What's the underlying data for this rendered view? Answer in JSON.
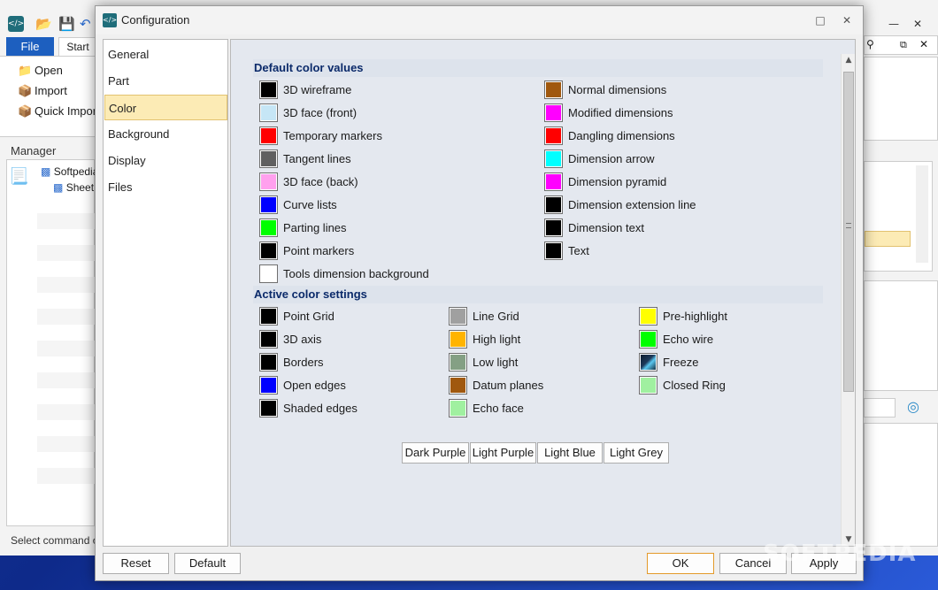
{
  "background_app": {
    "tabs": {
      "file": "File",
      "start": "Start"
    },
    "ribbon": [
      {
        "label": "Open",
        "icon": "folder-open-icon"
      },
      {
        "label": "Import",
        "icon": "import-icon"
      },
      {
        "label": "Quick Import",
        "icon": "quick-import-icon"
      }
    ],
    "manager_title": "Manager",
    "tree": [
      "Softpedia",
      "Sheet"
    ],
    "status_text": "Select command or"
  },
  "dialog": {
    "title": "Configuration",
    "nav": [
      "General",
      "Part",
      "Color",
      "Background",
      "Display",
      "Files"
    ],
    "selected_nav": "Color",
    "sections": [
      {
        "title": "Default color values",
        "columns": [
          [
            {
              "label": "3D wireframe",
              "color": "#000000"
            },
            {
              "label": "3D face (front)",
              "color": "#c6e6f6"
            },
            {
              "label": "Temporary markers",
              "color": "#ff0000"
            },
            {
              "label": "Tangent lines",
              "color": "#606060"
            },
            {
              "label": "3D face (back)",
              "color": "#ffa0ee"
            },
            {
              "label": "Curve lists",
              "color": "#0000ff"
            },
            {
              "label": "Parting lines",
              "color": "#00ff00"
            },
            {
              "label": "Point markers",
              "color": "#000000"
            },
            {
              "label": "Tools dimension background",
              "color": "#ffffff"
            }
          ],
          [
            {
              "label": "Normal dimensions",
              "color": "#a0580e"
            },
            {
              "label": "Modified dimensions",
              "color": "#ff00ff"
            },
            {
              "label": "Dangling dimensions",
              "color": "#ff0000"
            },
            {
              "label": "Dimension arrow",
              "color": "#00ffff"
            },
            {
              "label": "Dimension pyramid",
              "color": "#ff00ff"
            },
            {
              "label": "Dimension extension line",
              "color": "#000000"
            },
            {
              "label": "Dimension text",
              "color": "#000000"
            },
            {
              "label": "Text",
              "color": "#000000"
            }
          ]
        ]
      },
      {
        "title": "Active color settings",
        "columns": [
          [
            {
              "label": "Point Grid",
              "color": "#000000"
            },
            {
              "label": "3D axis",
              "color": "#000000"
            },
            {
              "label": "Borders",
              "color": "#000000"
            },
            {
              "label": "Open edges",
              "color": "#0000ff"
            },
            {
              "label": "Shaded edges",
              "color": "#000000"
            }
          ],
          [
            {
              "label": "Line Grid",
              "color": "#a0a0a0"
            },
            {
              "label": "High light",
              "color": "#ffb400"
            },
            {
              "label": "Low light",
              "color": "#84a084"
            },
            {
              "label": "Datum planes",
              "color": "#a0580e"
            },
            {
              "label": "Echo face",
              "color": "#a0f0a0"
            }
          ],
          [
            {
              "label": "Pre-highlight",
              "color": "#ffff00"
            },
            {
              "label": "Echo wire",
              "color": "#00ff00"
            },
            {
              "label": "Freeze",
              "color": "#1e3a5a"
            },
            {
              "label": "Closed Ring",
              "color": "#a0f0a0"
            }
          ]
        ]
      }
    ],
    "themes": [
      "Dark Purple",
      "Light Purple",
      "Light Blue",
      "Light Grey"
    ],
    "buttons": {
      "reset": "Reset",
      "default": "Default",
      "ok": "OK",
      "cancel": "Cancel",
      "apply": "Apply"
    }
  },
  "watermark": "SOFTPEDIA"
}
